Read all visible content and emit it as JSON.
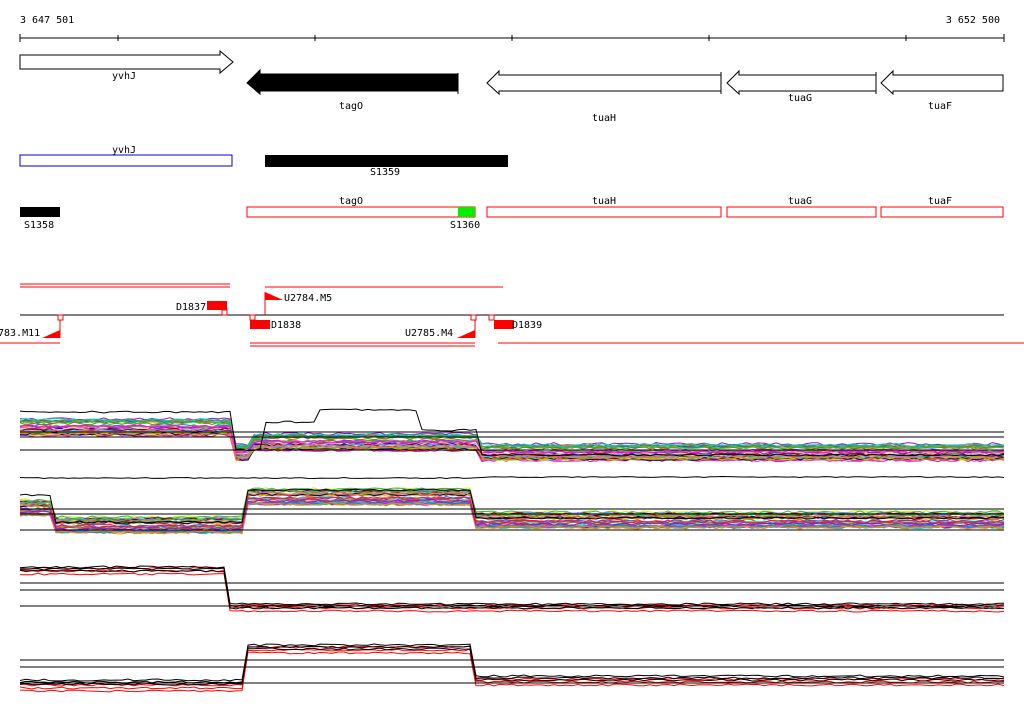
{
  "ruler": {
    "start": "3 647 501",
    "end": "3 652 500"
  },
  "genes_top": [
    {
      "name": "yvhJ",
      "fill": "#ffffff",
      "dir": "right"
    },
    {
      "name": "tagO",
      "fill": "#000000",
      "dir": "left"
    },
    {
      "name": "tuaH",
      "fill": "#ffffff",
      "dir": "left"
    },
    {
      "name": "tuaG",
      "fill": "#ffffff",
      "dir": "left"
    },
    {
      "name": "tuaF",
      "fill": "#ffffff",
      "dir": "left"
    }
  ],
  "track2": [
    {
      "label": "yvhJ",
      "style": "blue-outline"
    },
    {
      "label": "S1359",
      "style": "black"
    }
  ],
  "track3": [
    {
      "label": "S1358",
      "style": "black"
    },
    {
      "label": "tagO",
      "style": "red-outline"
    },
    {
      "label": "S1360",
      "style": "green"
    },
    {
      "label": "tuaH",
      "style": "red-outline"
    },
    {
      "label": "tuaG",
      "style": "red-outline"
    },
    {
      "label": "tuaF",
      "style": "red-outline"
    }
  ],
  "features": {
    "D1837": "D1837",
    "U2784": "U2784.M5",
    "D1838": "D1838",
    "U2785": "U2785.M4",
    "D1839": "D1839",
    "U2783": "783.M11"
  },
  "colors": {
    "red": "#ff0000",
    "green": "#00ee00",
    "blue": "#0000cc",
    "black": "#000000"
  },
  "expression_panels": [
    {
      "name": "panel-1",
      "pattern": "high-low-tuaH-plateau"
    },
    {
      "name": "panel-2",
      "pattern": "low-high-tagO"
    },
    {
      "name": "panel-3",
      "pattern": "high-low-red-black"
    },
    {
      "name": "panel-4",
      "pattern": "low-high-red-black"
    }
  ]
}
